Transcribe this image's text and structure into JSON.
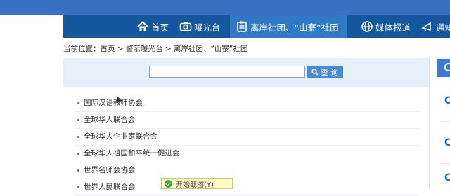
{
  "nav": {
    "items": [
      {
        "label": "首页",
        "icon": "home-icon"
      },
      {
        "label": "曝光台",
        "icon": "camera-icon"
      },
      {
        "label": "离岸社团、“山寨”社团",
        "icon": "clipboard-icon",
        "active": true
      },
      {
        "label": "媒体报道",
        "icon": "globe-icon"
      },
      {
        "label": "通知",
        "icon": "megaphone-icon"
      }
    ]
  },
  "breadcrumb": "当前位置：首页 > 警示曝光台 > 离岸社团、“山寨”社团",
  "search": {
    "value": "",
    "button_label": "查 询"
  },
  "list": [
    "国际汉语教师协会",
    "全球华人联合会",
    "全球华人企业家联合会",
    "全球华人祖国和平统一促进会",
    "世界名师会协会",
    "世界人民联合会"
  ],
  "side": {
    "links": [
      "C",
      "C",
      "C"
    ]
  },
  "tooltip": {
    "label": "开始截图(Y)"
  },
  "colors": {
    "nav_bg": "#13579d",
    "nav_active": "#2f79c6",
    "top_strip": "#3b6fc1",
    "search_panel": "#e6f0fb",
    "search_button": "#4a89d4"
  }
}
